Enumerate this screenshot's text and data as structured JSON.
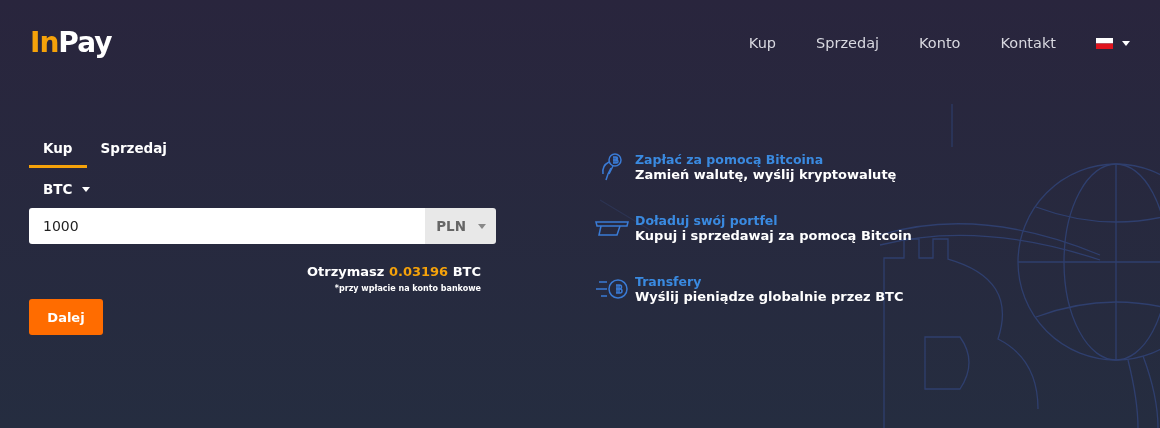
{
  "logo": {
    "prefix": "In",
    "suffix": "Pay"
  },
  "nav": [
    {
      "label": "Kup"
    },
    {
      "label": "Sprzedaj"
    },
    {
      "label": "Konto"
    },
    {
      "label": "Kontakt"
    }
  ],
  "tabs": [
    {
      "label": "Kup",
      "selected": true
    },
    {
      "label": "Sprzedaj",
      "selected": false
    }
  ],
  "crypto_select": {
    "value": "BTC"
  },
  "amount_field": {
    "value": "1000"
  },
  "currency_select": {
    "value": "PLN"
  },
  "result": {
    "label": "Otrzymasz",
    "amount": "0.03196",
    "unit": "BTC",
    "note": "*przy wpłacie na konto bankowe"
  },
  "next_button": "Dalej",
  "features": [
    {
      "kind": "pay",
      "title": "Zapłać za pomocą Bitcoina",
      "text": "Zamień walutę, wyślij kryptowalutę"
    },
    {
      "kind": "wallet",
      "title": "Doładuj swój portfel",
      "text": "Kupuj i sprzedawaj za pomocą Bitcoin"
    },
    {
      "kind": "transfer",
      "title": "Transfery",
      "text": "Wyślij pieniądze globalnie przez BTC"
    }
  ]
}
